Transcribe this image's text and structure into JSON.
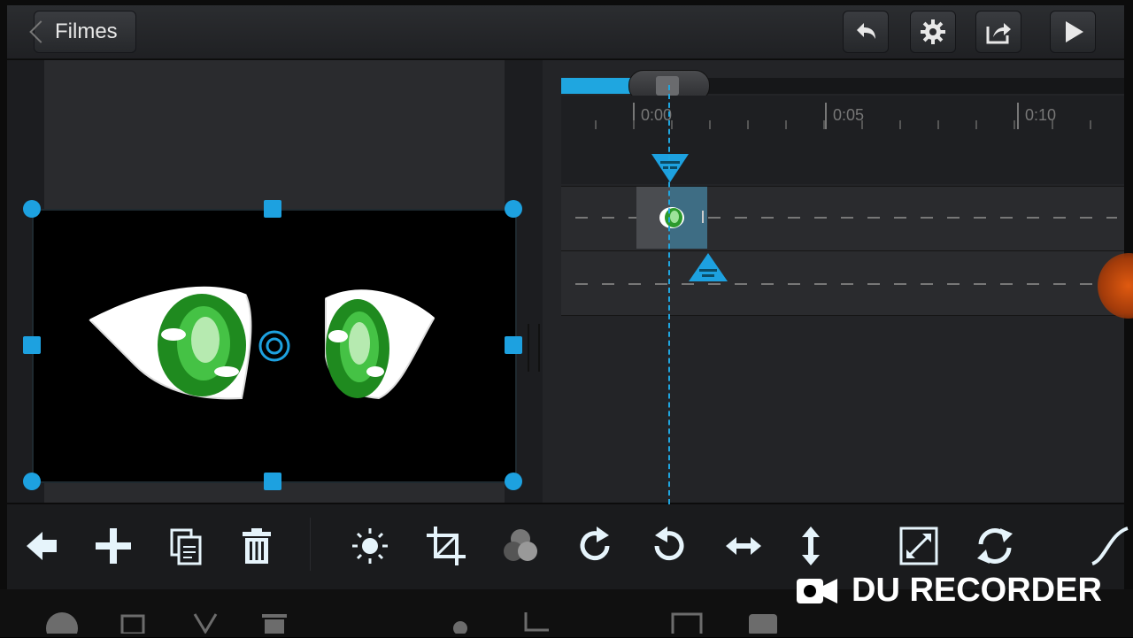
{
  "topbar": {
    "back_label": "Filmes",
    "buttons": [
      "undo-icon",
      "gear-icon",
      "share-icon",
      "play-icon"
    ]
  },
  "timeline": {
    "ruler_labels": [
      "0:00",
      "0:05",
      "0:10"
    ]
  },
  "toolbar": {
    "tools": [
      "back-arrow-icon",
      "add-icon",
      "copy-icon",
      "delete-icon",
      "brightness-icon",
      "crop-icon",
      "color-icon",
      "rotate-right-icon",
      "rotate-left-icon",
      "flip-horizontal-icon",
      "flip-vertical-icon",
      "fit-icon",
      "refresh-icon",
      "curve-icon"
    ]
  },
  "watermark": {
    "text": "DU RECORDER"
  },
  "colors": {
    "accent": "#1fa6e0",
    "background": "#0c0c0c",
    "panel": "#232427"
  }
}
